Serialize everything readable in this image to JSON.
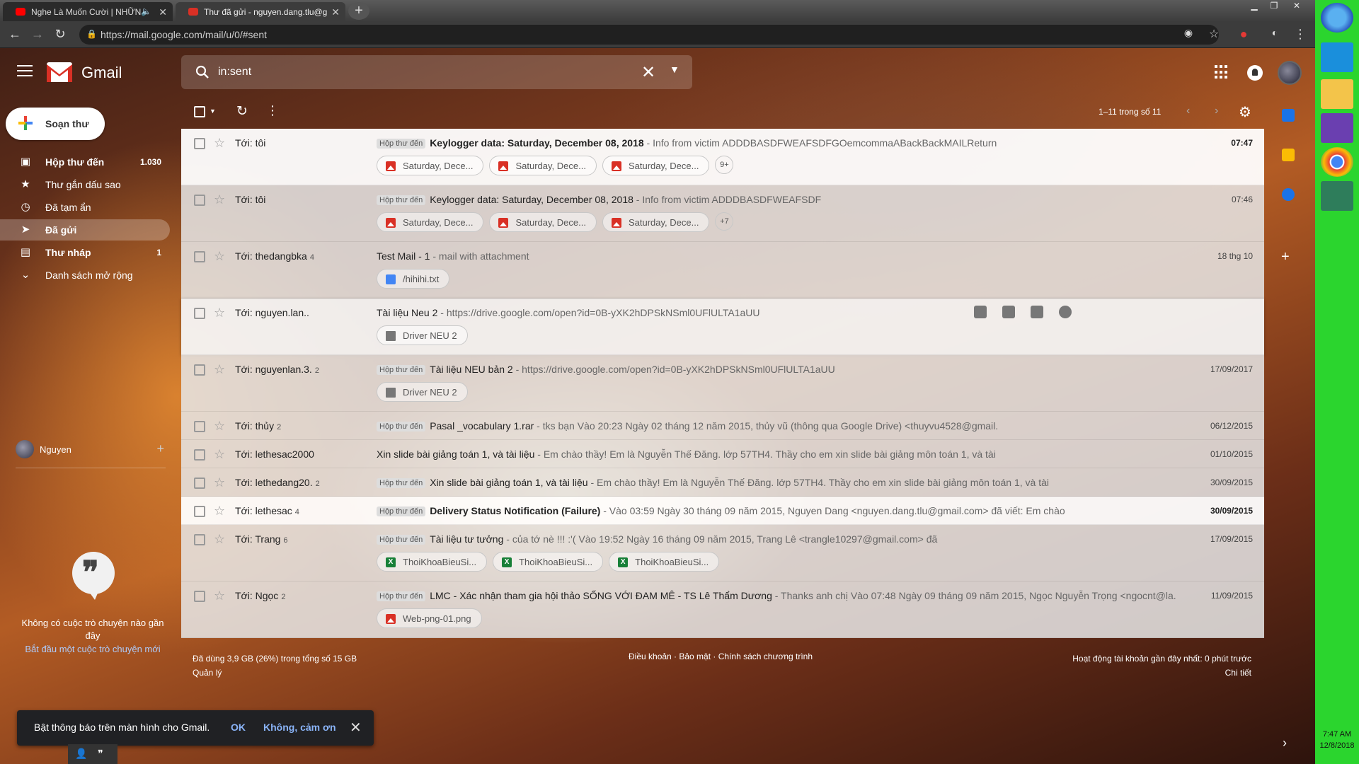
{
  "browser": {
    "tabs": [
      {
        "title": "Nghe Là Muốn Cười | NHỮN",
        "active": false,
        "icon_color": "#ff0000"
      },
      {
        "title": "Thư đã gửi - nguyen.dang.tlu@g",
        "active": true,
        "icon_color": "#d93025"
      }
    ],
    "url": "https://mail.google.com/mail/u/0/#sent"
  },
  "header": {
    "app_name": "Gmail",
    "search_value": "in:sent"
  },
  "sidebar": {
    "compose_label": "Soạn thư",
    "items": [
      {
        "label": "Hộp thư đến",
        "count": "1.030",
        "icon": "inbox-icon",
        "bold": true,
        "selected": false
      },
      {
        "label": "Thư gắn dấu sao",
        "count": "",
        "icon": "star-icon",
        "bold": false,
        "selected": false
      },
      {
        "label": "Đã tạm ẩn",
        "count": "",
        "icon": "clock-icon",
        "bold": false,
        "selected": false
      },
      {
        "label": "Đã gửi",
        "count": "",
        "icon": "send-icon",
        "bold": true,
        "selected": true
      },
      {
        "label": "Thư nháp",
        "count": "1",
        "icon": "draft-icon",
        "bold": true,
        "selected": false
      },
      {
        "label": "Danh sách mở rộng",
        "count": "",
        "icon": "chevron-down-icon",
        "bold": false,
        "selected": false
      }
    ]
  },
  "hangouts": {
    "user_name": "Nguyen",
    "empty_text": "Không có cuộc trò chuyện nào gần đây",
    "start_link": "Bắt đầu một cuộc trò chuyện mới"
  },
  "toolbar": {
    "page_range": "1–11 trong số 11"
  },
  "emails": [
    {
      "to": "Tới: tôi",
      "count": "",
      "label": "Hộp thư đến",
      "subject": "Keylogger data: Saturday, December 08, 2018",
      "snippet": " - Info from victim ADDDBASDFWEAFSDFGOemcommaABackBackMAILReturn",
      "date": "07:47",
      "unread": true,
      "chips": [
        {
          "name": "Saturday, Dece...",
          "type": "img"
        },
        {
          "name": "Saturday, Dece...",
          "type": "img"
        },
        {
          "name": "Saturday, Dece...",
          "type": "img"
        }
      ],
      "more": "9+"
    },
    {
      "to": "Tới: tôi",
      "count": "",
      "label": "Hộp thư đến",
      "subject": "Keylogger data: Saturday, December 08, 2018",
      "snippet": " - Info from victim ADDDBASDFWEAFSDF",
      "date": "07:46",
      "unread": false,
      "chips": [
        {
          "name": "Saturday, Dece...",
          "type": "img"
        },
        {
          "name": "Saturday, Dece...",
          "type": "img"
        },
        {
          "name": "Saturday, Dece...",
          "type": "img"
        }
      ],
      "more": "+7"
    },
    {
      "to": "Tới: thedangbka",
      "count": "4",
      "label": "",
      "subject": "Test Mail - 1",
      "snippet": " - mail with attachment",
      "date": "18 thg 10",
      "unread": false,
      "chips": [
        {
          "name": "/hihihi.txt",
          "type": "doc"
        }
      ],
      "more": ""
    },
    {
      "to": "Tới: nguyen.lan..",
      "count": "",
      "label": "",
      "subject": "Tài liệu Neu 2",
      "snippet": " - https://drive.google.com/open?id=0B-yXK2hDPSkNSml0UFlULTA1aUU",
      "date": "",
      "unread": false,
      "hover": true,
      "chips": [
        {
          "name": "Driver NEU 2",
          "type": "folder"
        }
      ],
      "more": ""
    },
    {
      "to": "Tới: nguyenlan.3.",
      "count": "2",
      "label": "Hộp thư đến",
      "subject": "Tài liệu NEU bản 2",
      "snippet": " - https://drive.google.com/open?id=0B-yXK2hDPSkNSml0UFlULTA1aUU",
      "date": "17/09/2017",
      "unread": false,
      "chips": [
        {
          "name": "Driver NEU 2",
          "type": "folder"
        }
      ],
      "more": ""
    },
    {
      "to": "Tới: thủy",
      "count": "2",
      "label": "Hộp thư đến",
      "subject": "Pasal _vocabulary 1.rar",
      "snippet": " - tks bạn Vào 20:23 Ngày 02 tháng 12 năm 2015, thủy vũ (thông qua Google Drive) <thuyvu4528@gmail.",
      "date": "06/12/2015",
      "unread": false,
      "chips": [],
      "more": ""
    },
    {
      "to": "Tới: lethesac2000",
      "count": "",
      "label": "",
      "subject": "Xin slide bài giảng toán 1, và tài liệu",
      "snippet": " - Em chào thầy! Em là Nguyễn Thế Đăng. lớp 57TH4. Thầy cho em xin slide bài giảng môn toán 1, và tài",
      "date": "01/10/2015",
      "unread": false,
      "chips": [],
      "more": ""
    },
    {
      "to": "Tới: lethedang20.",
      "count": "2",
      "label": "Hộp thư đến",
      "subject": "Xin slide bài giảng toán 1, và tài liệu",
      "snippet": " - Em chào thầy! Em là Nguyễn Thế Đăng. lớp 57TH4. Thầy cho em xin slide bài giảng môn toán 1, và tài",
      "date": "30/09/2015",
      "unread": false,
      "chips": [],
      "more": ""
    },
    {
      "to": "Tới: lethesac",
      "count": "4",
      "label": "Hộp thư đến",
      "subject": "Delivery Status Notification (Failure)",
      "snippet": " - Vào 03:59 Ngày 30 tháng 09 năm 2015, Nguyen Dang <nguyen.dang.tlu@gmail.com> đã viết: Em chào",
      "date": "30/09/2015",
      "unread": true,
      "chips": [],
      "more": ""
    },
    {
      "to": "Tới: Trang",
      "count": "6",
      "label": "Hộp thư đến",
      "subject": "Tài liệu tư tưởng",
      "snippet": " - của tớ nè !!! :'( Vào 19:52 Ngày 16 tháng 09 năm 2015, Trang Lê <trangle10297@gmail.com> đã",
      "date": "17/09/2015",
      "unread": false,
      "chips": [
        {
          "name": "ThoiKhoaBieuSi...",
          "type": "xls"
        },
        {
          "name": "ThoiKhoaBieuSi...",
          "type": "xls"
        },
        {
          "name": "ThoiKhoaBieuSi...",
          "type": "xls"
        }
      ],
      "more": ""
    },
    {
      "to": "Tới: Ngọc",
      "count": "2",
      "label": "Hộp thư đến",
      "subject": "LMC - Xác nhận tham gia hội thảo SỐNG VỚI ĐAM MÊ - TS Lê Thẩm Dương",
      "snippet": " - Thanks anh chị Vào 07:48 Ngày 09 tháng 09 năm 2015, Ngọc Nguyễn Trọng <ngocnt@la...",
      "date": "11/09/2015",
      "unread": false,
      "chips": [
        {
          "name": "Web-png-01.png",
          "type": "img"
        }
      ],
      "more": ""
    }
  ],
  "footer": {
    "storage": "Đã dùng 3,9 GB (26%) trong tổng số 15 GB",
    "manage": "Quản lý",
    "links": "Điều khoản · Bảo mật · Chính sách chương trình",
    "activity": "Hoạt động tài khoản gần đây nhất: 0 phút trước",
    "details": "Chi tiết"
  },
  "snackbar": {
    "message": "Bật thông báo trên màn hình cho Gmail.",
    "ok": "OK",
    "no": "Không, cảm ơn"
  },
  "taskbar": {
    "time": "7:47 AM",
    "date": "12/8/2018"
  }
}
